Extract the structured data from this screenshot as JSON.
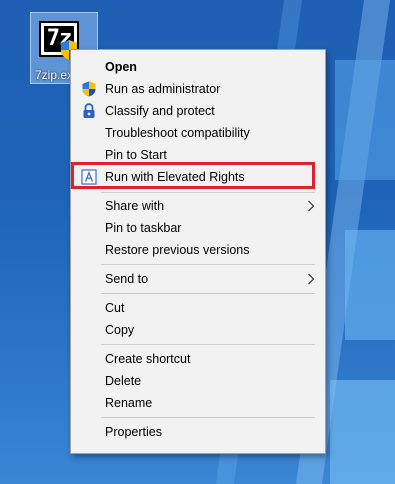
{
  "desktop": {
    "file_icon_label": "7zip.ex",
    "logo_text": "7z"
  },
  "menu": {
    "items": [
      {
        "label": "Open",
        "icon": "none"
      },
      {
        "label": "Run as administrator",
        "icon": "uac-shield-icon"
      },
      {
        "label": "Classify and protect",
        "icon": "lock-icon"
      },
      {
        "label": "Troubleshoot compatibility",
        "icon": "none"
      },
      {
        "label": "Pin to Start",
        "icon": "none"
      },
      {
        "label": "Run with Elevated Rights",
        "icon": "elevated-rights-icon"
      },
      {
        "label": "Share with",
        "icon": "chevron-right-icon"
      },
      {
        "label": "Pin to taskbar",
        "icon": "none"
      },
      {
        "label": "Restore previous versions",
        "icon": "none"
      },
      {
        "label": "Send to",
        "icon": "chevron-right-icon"
      },
      {
        "label": "Cut",
        "icon": "none"
      },
      {
        "label": "Copy",
        "icon": "none"
      },
      {
        "label": "Create shortcut",
        "icon": "none"
      },
      {
        "label": "Delete",
        "icon": "none"
      },
      {
        "label": "Rename",
        "icon": "none"
      },
      {
        "label": "Properties",
        "icon": "none"
      }
    ],
    "highlight_color": "#e0202a"
  }
}
